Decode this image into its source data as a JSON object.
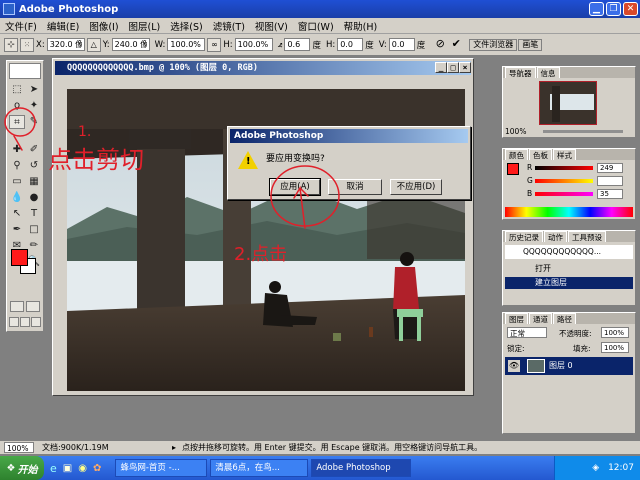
{
  "window": {
    "title": "Adobe Photoshop"
  },
  "menu": {
    "items": [
      "文件(F)",
      "编辑(E)",
      "图像(I)",
      "图层(L)",
      "选择(S)",
      "滤镜(T)",
      "视图(V)",
      "窗口(W)",
      "帮助(H)"
    ]
  },
  "options": {
    "x_label": "X:",
    "x_value": "320.0 像",
    "y_label": "Y:",
    "y_value": "240.0 像",
    "w_label": "W:",
    "w_value": "100.0%",
    "h_label": "H:",
    "h_value": "100.0%",
    "angle_value": "0.6",
    "angle_unit": "度",
    "hskew_label": "H:",
    "hskew_value": "0.0",
    "hskew_unit": "度",
    "vskew_label": "V:",
    "vskew_value": "0.0",
    "vskew_unit": "度",
    "palette_tabs": [
      "文件浏览器",
      "画笔"
    ]
  },
  "document": {
    "title": "QQQQQQQQQQQQQ.bmp @ 100% (图层 0, RGB)"
  },
  "dialog": {
    "title": "Adobe Photoshop",
    "message": "要应用变换吗?",
    "apply_label": "应用(A)",
    "cancel_label": "取消",
    "dont_apply_label": "不应用(D)"
  },
  "navigator": {
    "tabs": [
      "导航器",
      "信息"
    ],
    "zoom": "100%"
  },
  "color_panel": {
    "tabs": [
      "颜色",
      "色板",
      "样式"
    ],
    "r_label": "R",
    "r_value": "249",
    "g_label": "G",
    "g_value": "",
    "b_label": "B",
    "b_value": "35"
  },
  "history_panel": {
    "tabs": [
      "历史记录",
      "动作",
      "工具预设"
    ],
    "snapshot": "QQQQQQQQQQQQ...",
    "items": [
      "打开",
      "建立图层"
    ]
  },
  "layers_panel": {
    "tabs": [
      "图层",
      "通道",
      "路径"
    ],
    "blend_mode": "正常",
    "opacity_label": "不透明度:",
    "opacity_value": "100%",
    "lock_label": "锁定:",
    "fill_label": "填充:",
    "fill_value": "100%",
    "layer_name": "图层 0"
  },
  "statusbar": {
    "zoom": "100%",
    "doc_size": "文档:900K/1.19M",
    "hint": "点按并拖移可旋转。用 Enter 键提交。用 Escape 键取消。用空格键访问导航工具。"
  },
  "taskbar": {
    "start_label": "开始",
    "tasks": [
      "蜂鸟网-首页 -...",
      "清晨6点，在鸟...",
      "Adobe Photoshop"
    ],
    "clock": "12:07"
  },
  "annotations": {
    "note1": "点击剪切",
    "note2": "2.点击",
    "num1": "1."
  },
  "colors": {
    "titlebar": "#1a3fa8",
    "annotation": "#e0202a",
    "foreground": "#ff1a1a"
  }
}
